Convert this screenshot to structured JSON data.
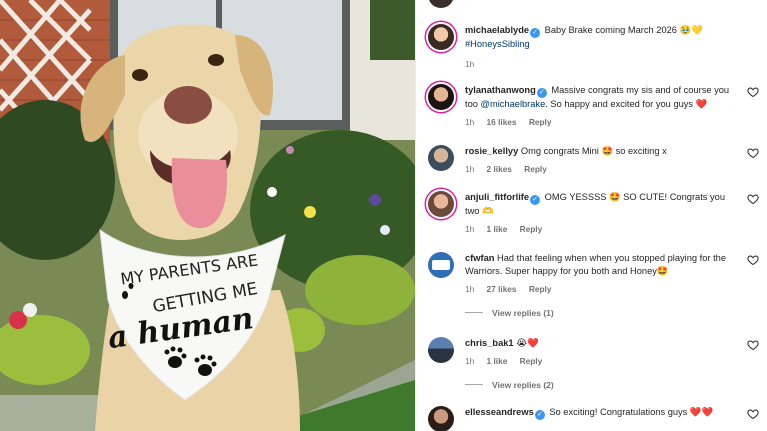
{
  "post": {
    "bandana_line1": "MY PARENTS ARE",
    "bandana_line2": "GETTING ME",
    "bandana_line3": "a human"
  },
  "caption": {
    "username": "michaelablyde",
    "text": "Baby Brake coming March 2026 🥹💛",
    "hashtag": "#HoneysSibling",
    "time": "1h"
  },
  "comments": [
    {
      "username": "tylanathanwong",
      "verified": true,
      "text": "Massive congrats my sis and of course you too",
      "mention": "@michaelbrake",
      "text_after": ". So happy and excited for you guys ❤️",
      "time": "1h",
      "likes": "16 likes",
      "reply": "Reply"
    },
    {
      "username": "rosie_kellyy",
      "verified": false,
      "text": "Omg congrats Mini 🤩 so exciting x",
      "time": "1h",
      "likes": "2 likes",
      "reply": "Reply"
    },
    {
      "username": "anjuli_fitforlife",
      "verified": true,
      "text": "OMG YESSSS 🤩 SO CUTE! Congrats you two 🫶",
      "time": "1h",
      "likes": "1 like",
      "reply": "Reply"
    },
    {
      "username": "cfwfan",
      "verified": false,
      "text": "Had that feeling when when you stopped playing for the Warriors. Super happy for you both and Honey🤩",
      "time": "1h",
      "likes": "27 likes",
      "reply": "Reply"
    },
    {
      "username": "chris_bak1",
      "verified": false,
      "text": "😭❤️",
      "time": "1h",
      "likes": "1 like",
      "reply": "Reply"
    },
    {
      "username": "ellesseandrews",
      "verified": true,
      "text": "So exciting! Congratulations guys ❤️❤️",
      "time": "",
      "likes": "",
      "reply": ""
    }
  ],
  "view_replies": [
    "View replies (1)",
    "View replies (2)"
  ]
}
